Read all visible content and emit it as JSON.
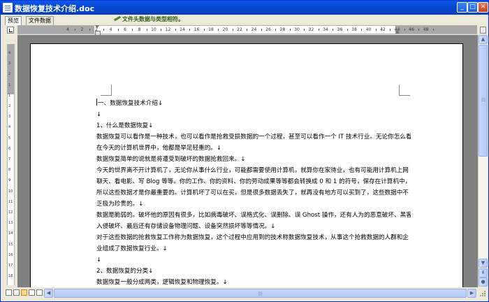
{
  "window": {
    "title": "数据恢复技术介绍.doc",
    "controls": {
      "minimize": "_",
      "maximize": "□",
      "close": "✕"
    }
  },
  "tabs": [
    {
      "label": "预览",
      "active": true
    },
    {
      "label": "文件数据",
      "active": false
    }
  ],
  "status_tip": "文件头数据与类型相符。",
  "ruler": {
    "horizontal_numbers": [
      "4",
      "2",
      "2",
      "4",
      "6",
      "8",
      "10",
      "12",
      "14",
      "16",
      "18",
      "20",
      "22",
      "24",
      "26",
      "28",
      "30",
      "32",
      "34",
      "36",
      "38",
      "40",
      "42",
      "44",
      "46",
      "48"
    ],
    "vertical_numbers": [
      "4",
      "3",
      "2",
      "1",
      "1",
      "2",
      "3",
      "4",
      "5",
      "6",
      "7",
      "8",
      "9",
      "10",
      "11",
      "12",
      "13",
      "14",
      "15",
      "16",
      "17",
      "18"
    ]
  },
  "document": {
    "paragraphs": [
      "一、数据恢复技术介绍↓",
      "↓",
      "1、什么是数据恢复↓",
      "数据恢复可以看作是一种技术，也可以看作是抢救受损数据的一个过程，甚至可以看作一个 IT 技术行业。无论你怎么看，",
      "在今天的计算机世界中，他都是举足轻重的。↓",
      "数据恢复简单的说就是将遭受到破坏的数据抢救回来。↓",
      "今天的世界离不开计算机了，无论你从事什么行业，可能都需要使用计算机，就算你在家待业，也有可能用计算机上网",
      "聊天、看电影、写 Blog 等等。你的工作、你的资料、你的劳动成果等等都会转换成 0 和 1 的符号，保存在计算机中，",
      "所以这些数据才是你最重要的。计算机坏了可以在买，但是很多数据丢失了，就再没有地方可以买到了，这些数据中不",
      "乏极为珍贵的。↓",
      "数据是脆弱的。破坏他的原因有很多，比如病毒破坏、误格式化、误删除、误 Ghost 操作，还有人为的恶意破坏、黑客",
      "入侵破坏、最后还有存储设备物理问题、设备突然损坏等等情况。↓",
      "对于这些数据的抢救恢复工作称为数据恢复，这个过程中应用到的技术称数据恢复技术，从事这个抢救数据的人群和企",
      "业组成了数据恢复行业。↓",
      "↓",
      "2、数据恢复的分类↓",
      "数据恢复一般分成两类，逻辑恢复和物理恢复。↓"
    ]
  },
  "scrollbar": {
    "up": "▲",
    "down": "▼",
    "prev_page": "⇞",
    "select_browse": "●",
    "left": "◀",
    "right": "▶"
  },
  "colors": {
    "titlebar": "#0a5ae8",
    "status_tip": "#2c5f1f",
    "page_bg": "#808080"
  }
}
